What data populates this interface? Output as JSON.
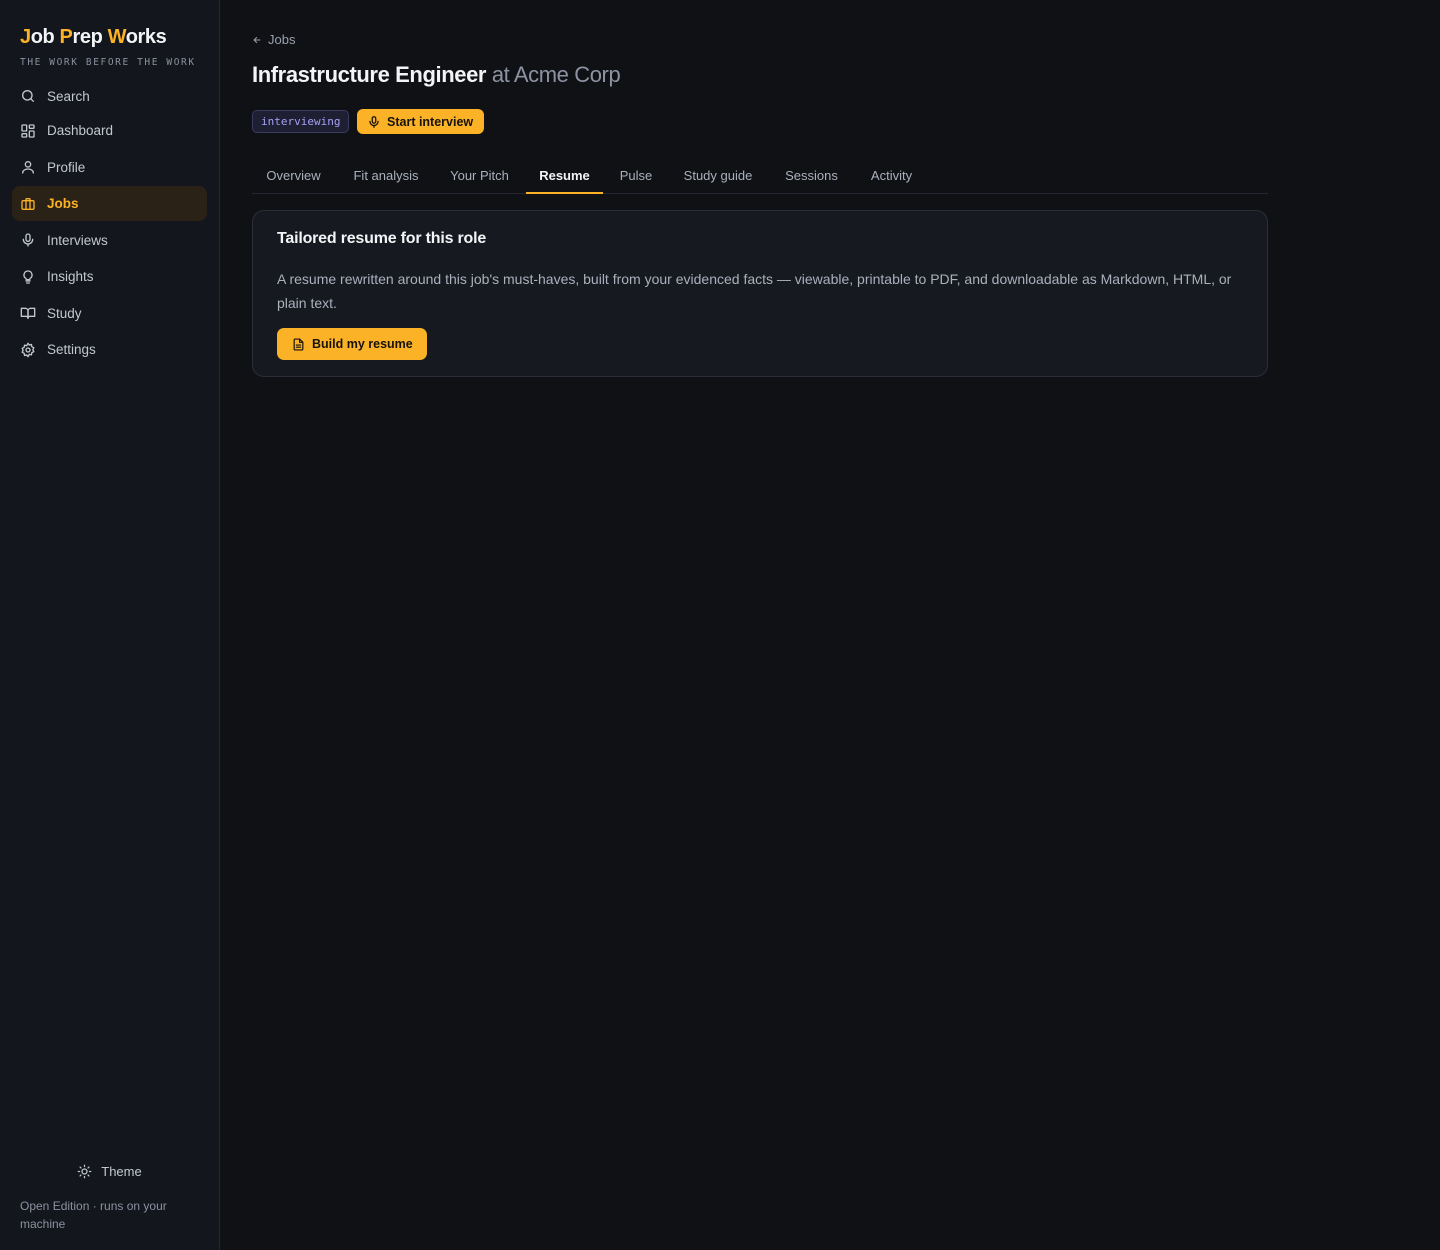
{
  "brand": {
    "name_parts": [
      "J",
      "ob ",
      "P",
      "rep ",
      "W",
      "orks"
    ],
    "tagline": "THE WORK BEFORE THE WORK"
  },
  "sidebar": {
    "items": [
      {
        "label": "Search",
        "icon": "search-icon"
      },
      {
        "label": "Dashboard",
        "icon": "dashboard-icon"
      },
      {
        "label": "Profile",
        "icon": "user-icon"
      },
      {
        "label": "Jobs",
        "icon": "briefcase-icon",
        "active": true
      },
      {
        "label": "Interviews",
        "icon": "microphone-icon"
      },
      {
        "label": "Insights",
        "icon": "lightbulb-icon"
      },
      {
        "label": "Study",
        "icon": "book-icon"
      },
      {
        "label": "Settings",
        "icon": "gear-icon"
      }
    ],
    "theme_label": "Theme",
    "edition": "Open Edition · runs on your machine"
  },
  "header": {
    "back_label": "Jobs",
    "title": "Infrastructure Engineer",
    "company": "at Acme Corp",
    "status": "interviewing",
    "start_interview_label": "Start interview"
  },
  "tabs": [
    {
      "label": "Overview"
    },
    {
      "label": "Fit analysis"
    },
    {
      "label": "Your Pitch"
    },
    {
      "label": "Resume",
      "active": true
    },
    {
      "label": "Pulse"
    },
    {
      "label": "Study guide"
    },
    {
      "label": "Sessions"
    },
    {
      "label": "Activity"
    }
  ],
  "resume_card": {
    "title": "Tailored resume for this role",
    "description": "A resume rewritten around this job's must-haves, built from your evidenced facts — viewable, printable to PDF, and downloadable as Markdown, HTML, or plain text.",
    "button_label": "Build my resume"
  },
  "colors": {
    "accent": "#fbb227",
    "background": "#0f1115",
    "sidebar": "#13161c",
    "status_badge_text": "#a7a0f2"
  }
}
